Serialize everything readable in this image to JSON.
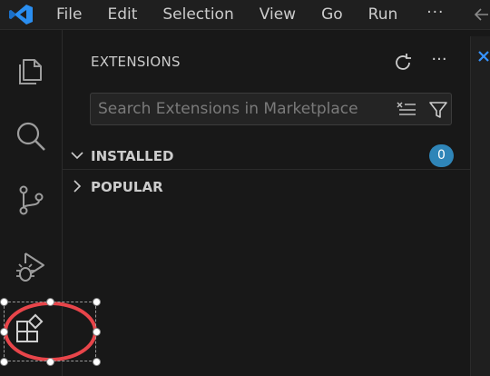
{
  "titlebar": {
    "menu": [
      "File",
      "Edit",
      "Selection",
      "View",
      "Go",
      "Run"
    ],
    "more_label": "···"
  },
  "activitybar": {
    "items": [
      "explorer-icon",
      "search-icon",
      "source-control-icon",
      "run-debug-icon",
      "extensions-icon"
    ]
  },
  "sidebar": {
    "title": "EXTENSIONS",
    "search_placeholder": "Search Extensions in Marketplace",
    "more_label": "···",
    "sections": [
      {
        "label": "INSTALLED",
        "badge": "0",
        "expanded": true
      },
      {
        "label": "POPULAR",
        "expanded": false
      }
    ]
  },
  "colors": {
    "accent": "#0078d4",
    "badge": "#2f85b8",
    "highlight": "#e8454a"
  }
}
